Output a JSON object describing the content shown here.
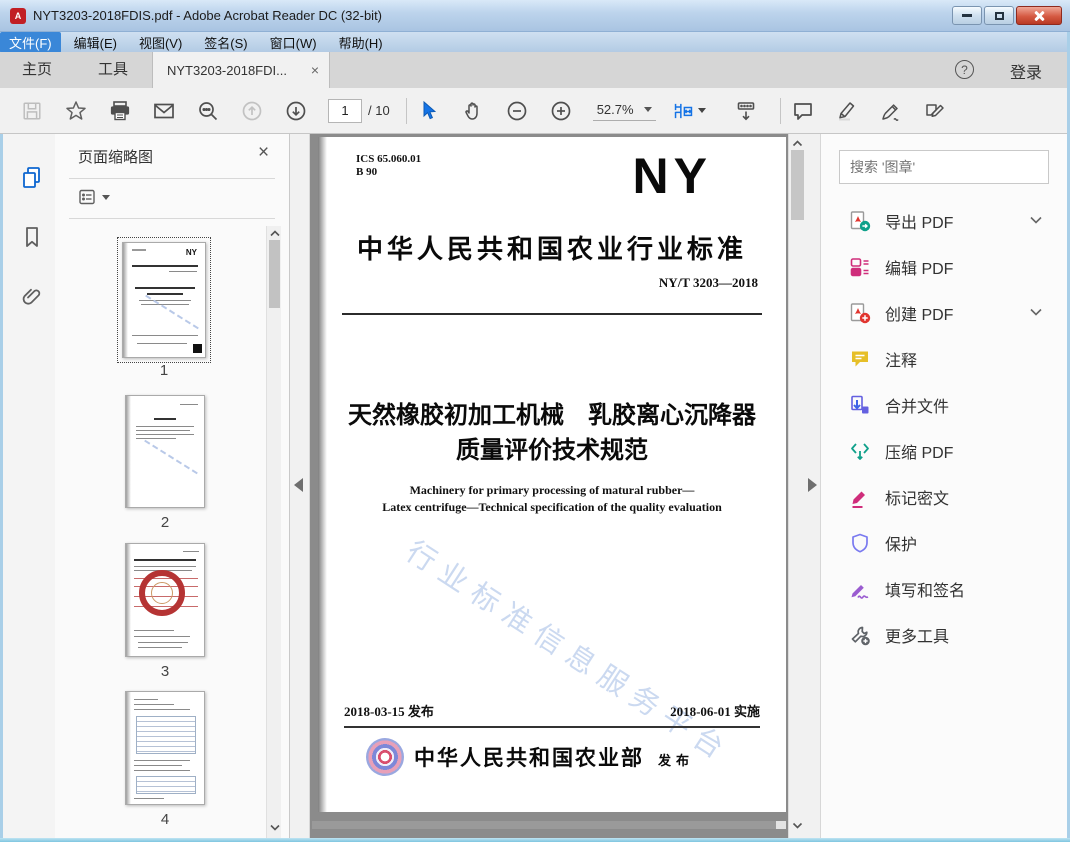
{
  "window": {
    "title": "NYT3203-2018FDIS.pdf - Adobe Acrobat Reader DC (32-bit)",
    "menus": [
      {
        "label": "文件(F)"
      },
      {
        "label": "编辑(E)"
      },
      {
        "label": "视图(V)"
      },
      {
        "label": "签名(S)"
      },
      {
        "label": "窗口(W)"
      },
      {
        "label": "帮助(H)"
      }
    ]
  },
  "ui": {
    "close_glyph": "×",
    "help_glyph": "?",
    "pdf_badge": "A"
  },
  "tabs": {
    "home": "主页",
    "tools": "工具",
    "document": "NYT3203-2018FDI...",
    "signin": "登录"
  },
  "toolbar": {
    "page_current": "1",
    "page_total_label": "/ 10",
    "zoom_level": "52.7%"
  },
  "left_panel": {
    "title": "页面缩略图",
    "thumbnails": [
      {
        "label": "1"
      },
      {
        "label": "2"
      },
      {
        "label": "3"
      },
      {
        "label": "4"
      }
    ]
  },
  "document": {
    "ics_line1": "ICS 65.060.01",
    "ics_line2": "B 90",
    "logo": "NY",
    "heading": "中华人民共和国农业行业标准",
    "code": "NY/T 3203—2018",
    "title_line1": "天然橡胶初加工机械　乳胶离心沉降器",
    "title_line2": "质量评价技术规范",
    "en_line1": "Machinery for primary processing of matural rubber—",
    "en_line2": "Latex centrifuge—Technical specification of the quality evaluation",
    "watermark": "行业标准信息服务平台",
    "issue_date": "2018-03-15 发布",
    "impl_date": "2018-06-01 实施",
    "publisher": "中华人民共和国农业部",
    "publish_word": "发布"
  },
  "right_panel": {
    "search_placeholder": "搜索 '图章'",
    "tools": [
      {
        "label": "导出 PDF",
        "icon": "export-pdf-icon",
        "chevron": true
      },
      {
        "label": "编辑 PDF",
        "icon": "edit-pdf-icon",
        "chevron": false
      },
      {
        "label": "创建 PDF",
        "icon": "create-pdf-icon",
        "chevron": true
      },
      {
        "label": "注释",
        "icon": "comment-icon",
        "chevron": false
      },
      {
        "label": "合并文件",
        "icon": "combine-files-icon",
        "chevron": false
      },
      {
        "label": "压缩 PDF",
        "icon": "compress-pdf-icon",
        "chevron": false
      },
      {
        "label": "标记密文",
        "icon": "redact-icon",
        "chevron": false
      },
      {
        "label": "保护",
        "icon": "protect-icon",
        "chevron": false
      },
      {
        "label": "填写和签名",
        "icon": "fill-sign-icon",
        "chevron": false
      },
      {
        "label": "更多工具",
        "icon": "more-tools-icon",
        "chevron": false
      }
    ]
  },
  "colors": {
    "accent_blue": "#1473e6",
    "teal": "#0fa08a",
    "magenta": "#cf2d7b",
    "red": "#e1352f",
    "yellow": "#e6bf28",
    "indigo": "#6460e0",
    "periwinkle": "#7a7af0",
    "purple": "#9a5cd0",
    "close_red": "#d55a43"
  }
}
